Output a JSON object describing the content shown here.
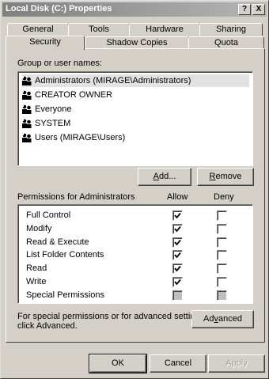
{
  "window": {
    "title": "Local Disk (C:) Properties",
    "help_btn": "?",
    "close_btn": "X"
  },
  "tabs_row1": [
    "General",
    "Tools",
    "Hardware",
    "Sharing"
  ],
  "tabs_row2": [
    "Security",
    "Shadow Copies",
    "Quota"
  ],
  "active_tab": "Security",
  "group_label": "Group or user names:",
  "users": [
    "Administrators (MIRAGE\\Administrators)",
    "CREATOR OWNER",
    "Everyone",
    "SYSTEM",
    "Users (MIRAGE\\Users)"
  ],
  "selected_user": 0,
  "add_label": "Add...",
  "remove_label": "Remove",
  "perm_label": "Permissions for Administrators",
  "allow_header": "Allow",
  "deny_header": "Deny",
  "permissions": [
    {
      "name": "Full Control",
      "allow": true,
      "deny": false
    },
    {
      "name": "Modify",
      "allow": true,
      "deny": false
    },
    {
      "name": "Read & Execute",
      "allow": true,
      "deny": false
    },
    {
      "name": "List Folder Contents",
      "allow": true,
      "deny": false
    },
    {
      "name": "Read",
      "allow": true,
      "deny": false
    },
    {
      "name": "Write",
      "allow": true,
      "deny": false
    },
    {
      "name": "Special Permissions",
      "allow": false,
      "deny": false,
      "grayed": true
    }
  ],
  "advanced_note_line1": "For special permissions or for advanced settings,",
  "advanced_note_line2": "click Advanced.",
  "advanced_label": "Advanced",
  "ok_label": "OK",
  "cancel_label": "Cancel",
  "apply_label": "Apply"
}
